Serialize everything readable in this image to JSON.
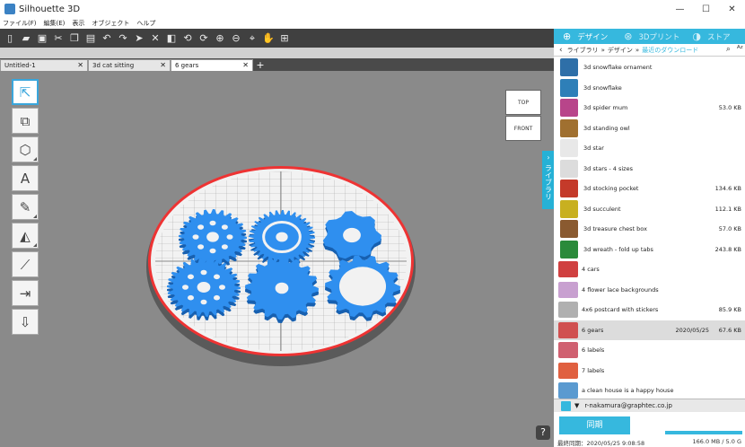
{
  "window": {
    "title": "Silhouette 3D",
    "minimize": "—",
    "maximize": "☐",
    "close": "✕"
  },
  "menu": [
    "ファイル(F)",
    "編集(E)",
    "表示",
    "オブジェクト",
    "ヘルプ"
  ],
  "toolbar_icons": [
    "new-file-icon",
    "open-folder-icon",
    "save-icon",
    "cut-icon",
    "copy-icon",
    "paste-icon",
    "undo-icon",
    "redo-icon",
    "send-icon",
    "delete-icon",
    "style-icon",
    "rotate-left-icon",
    "rotate-right-icon",
    "zoom-in-icon",
    "zoom-out-icon",
    "measure-icon",
    "pan-icon",
    "fit-page-icon"
  ],
  "tabs": [
    {
      "label": "Untitled-1",
      "close": "✕"
    },
    {
      "label": "3d cat sitting",
      "close": "✕"
    },
    {
      "label": "6 gears",
      "close": "✕"
    }
  ],
  "add_tab": "+",
  "left_tools": [
    "select-tool-icon",
    "node-tool-icon",
    "shape-tool-icon",
    "text-tool-icon",
    "draw-tool-icon",
    "extrude-tool-icon",
    "knife-tool-icon",
    "align-tool-icon",
    "position-tool-icon"
  ],
  "viewcube": {
    "top": "TOP",
    "front": "FRONT"
  },
  "help": "?",
  "library_tab": {
    "arrow": "›",
    "label": "ライブラリ"
  },
  "panel": {
    "tabs": [
      {
        "icon": "globe-icon",
        "label": "デザイン",
        "active": true
      },
      {
        "icon": "3d-print-icon",
        "label": "3Dプリント",
        "active": false
      },
      {
        "icon": "store-icon",
        "label": "ストア",
        "active": false
      }
    ],
    "breadcrumb": {
      "back": "‹",
      "items": [
        "ライブラリ",
        "デザイン",
        "最近のダウンロード"
      ],
      "separator": "»",
      "search_icon": "search-icon",
      "sort_icon": "sort-az-icon"
    },
    "items": [
      {
        "name": "3d snowflake ornament",
        "size": "",
        "date": "",
        "color": "#2e6fa8"
      },
      {
        "name": "3d snowflake",
        "size": "",
        "date": "",
        "color": "#2e7fb8"
      },
      {
        "name": "3d spider mum",
        "size": "53.0 KB",
        "date": "",
        "color": "#b8458a"
      },
      {
        "name": "3d standing owl",
        "size": "",
        "date": "",
        "color": "#a07030"
      },
      {
        "name": "3d star",
        "size": "",
        "date": "",
        "color": "#e8e8e8"
      },
      {
        "name": "3d stars - 4 sizes",
        "size": "",
        "date": "",
        "color": "#dcdcdc"
      },
      {
        "name": "3d stocking pocket",
        "size": "134.6 KB",
        "date": "",
        "color": "#c43a2a"
      },
      {
        "name": "3d succulent",
        "size": "112.1 KB",
        "date": "",
        "color": "#c8b020"
      },
      {
        "name": "3d treasure chest box",
        "size": "57.0 KB",
        "date": "",
        "color": "#8a5a30"
      },
      {
        "name": "3d wreath - fold up tabs",
        "size": "243.8 KB",
        "date": "",
        "color": "#2a8a3a"
      },
      {
        "name": "4 cars",
        "size": "",
        "date": "",
        "color": "#d04040"
      },
      {
        "name": "4 flower lace backgrounds",
        "size": "",
        "date": "",
        "color": "#c8a0d0"
      },
      {
        "name": "4x6 postcard with stickers",
        "size": "85.9 KB",
        "date": "",
        "color": "#b0b0b0"
      },
      {
        "name": "6 gears",
        "size": "67.6 KB",
        "date": "2020/05/25",
        "color": "#d05050",
        "selected": true
      },
      {
        "name": "6 labels",
        "size": "",
        "date": "",
        "color": "#d06070"
      },
      {
        "name": "7 labels",
        "size": "",
        "date": "",
        "color": "#e06040"
      },
      {
        "name": "a clean house is a happy house",
        "size": "",
        "date": "",
        "color": "#5a9ad0"
      }
    ],
    "user": {
      "icon": "user-icon",
      "caret": "▼",
      "email": "r-nakamura@graphtec.co.jp"
    },
    "sync_button": "同期",
    "storage_fraction": 0.96,
    "last_sync": "最終同期：2020/05/25 9:08:58",
    "quota": "166.0 MB / 5.0 G"
  },
  "gears": [
    {
      "teeth": 24
    },
    {
      "teeth": 32
    },
    {
      "teeth": 7
    },
    {
      "teeth": 26
    },
    {
      "teeth": 16
    },
    {
      "teeth": 14
    }
  ]
}
